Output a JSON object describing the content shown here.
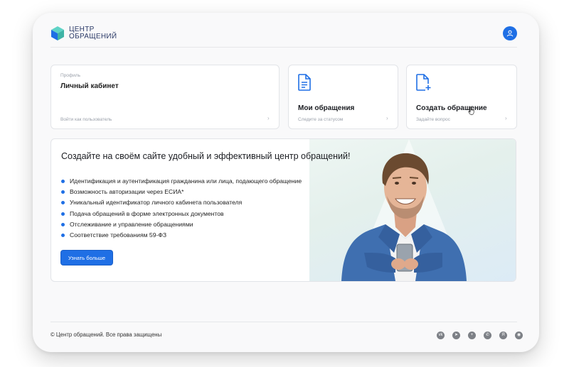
{
  "header": {
    "logo_line1": "ЦЕНТР",
    "logo_line2": "ОБРАЩЕНИЙ",
    "avatar_icon": "user-icon",
    "accent": "#1f6fe5"
  },
  "cards": [
    {
      "subtitle": "Профиль",
      "title": "Личный кабинет",
      "hint": "Войти как пользователь",
      "icon": "none"
    },
    {
      "title": "Мои обращения",
      "hint": "Следите за статусом",
      "icon": "document-icon"
    },
    {
      "title": "Создать обращение",
      "hint": "Задайте вопрос",
      "icon": "document-plus-icon"
    }
  ],
  "banner": {
    "heading": "Создайте на своём сайте удобный и эффективный центр обращений!",
    "bullets": [
      "Идентификация и аутентификация гражданина или лица, подающего обращение",
      "Возможность авторизации через ЕСИА*",
      "Уникальный идентификатор личного кабинета пользователя",
      "Подача обращений в форме электронных документов",
      "Отслеживание и управление обращениями",
      "Соответствие требованиям 59-ФЗ"
    ],
    "button_label": "Узнать больше"
  },
  "footer": {
    "copyright": "© Центр обращений. Все права защищены",
    "social_icons": [
      "vk-icon",
      "telegram-icon",
      "plus-icon",
      "whatsapp-icon",
      "yandex-icon",
      "odnoklassniki-icon"
    ]
  }
}
